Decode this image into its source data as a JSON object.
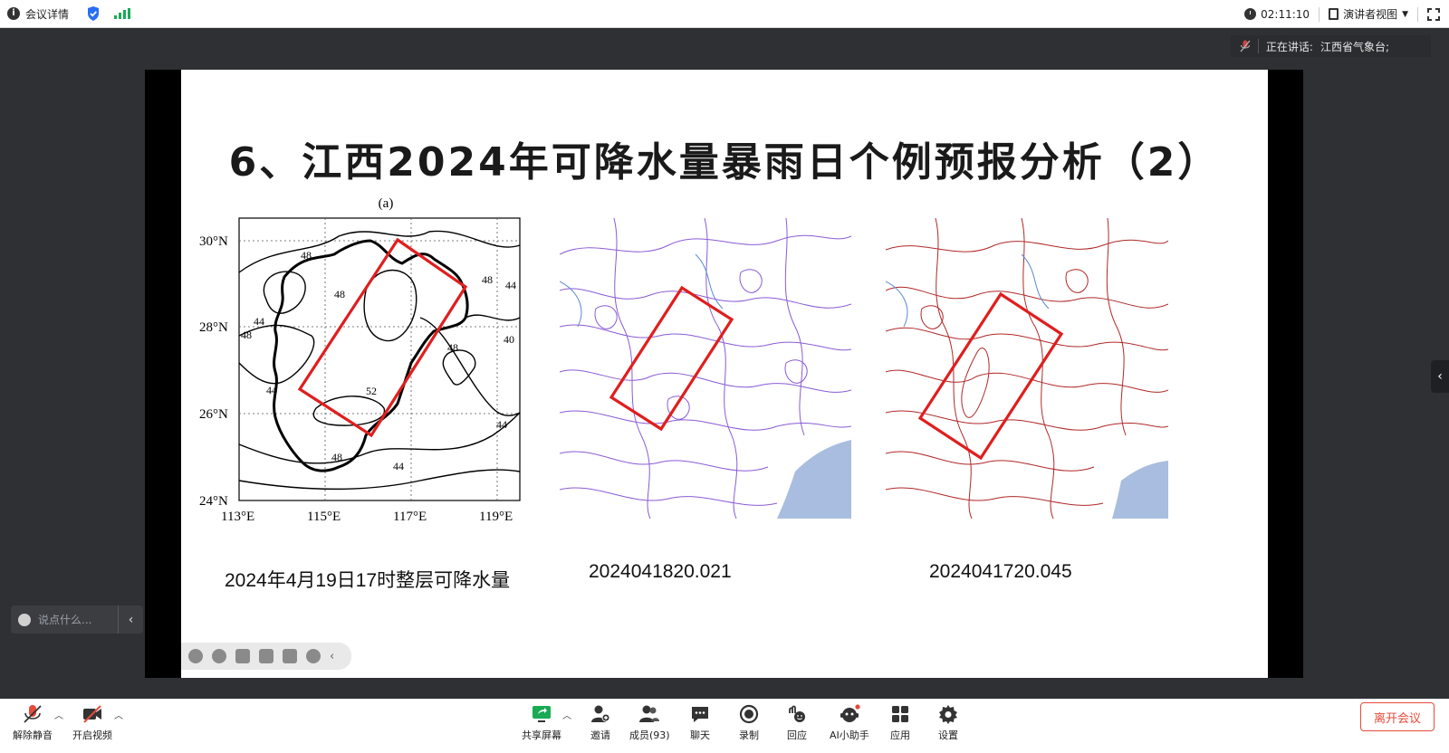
{
  "topbar": {
    "meeting_details_label": "会议详情",
    "timer": "02:11:10",
    "view_label": "演讲者视图"
  },
  "speaking": {
    "label": "正在讲话:",
    "name": "江西省气象台;"
  },
  "slide": {
    "title": "6、江西2024年可降水量暴雨日个例预报分析（2）",
    "captions": [
      "2024年4月19日17时整层可降水量",
      "2024041820.021",
      "2024041720.045"
    ],
    "panel_a": {
      "label": "(a)",
      "y_ticks": [
        "30°N",
        "28°N",
        "26°N",
        "24°N"
      ],
      "x_ticks": [
        "113°E",
        "115°E",
        "117°E",
        "119°E"
      ],
      "contour_labels": [
        "48",
        "44",
        "48",
        "44",
        "48",
        "52",
        "48",
        "44",
        "48",
        "44",
        "40",
        "48",
        "44"
      ]
    }
  },
  "chat": {
    "placeholder": "说点什么..."
  },
  "toolbar": {
    "unmute": "解除静音",
    "start_video": "开启视频",
    "share_screen": "共享屏幕",
    "invite": "邀请",
    "members": "成员(93)",
    "chat": "聊天",
    "record": "录制",
    "reactions": "回应",
    "ai_assistant": "AI小助手",
    "apps": "应用",
    "settings": "设置",
    "leave": "离开会议"
  },
  "colors": {
    "leave_red": "#e64a3b",
    "box_red": "#e01e1e",
    "contour_purple": "#8a5bd6",
    "contour_darkred": "#b02828",
    "signal_green": "#1aaa55",
    "shield_blue": "#2a6df5"
  }
}
